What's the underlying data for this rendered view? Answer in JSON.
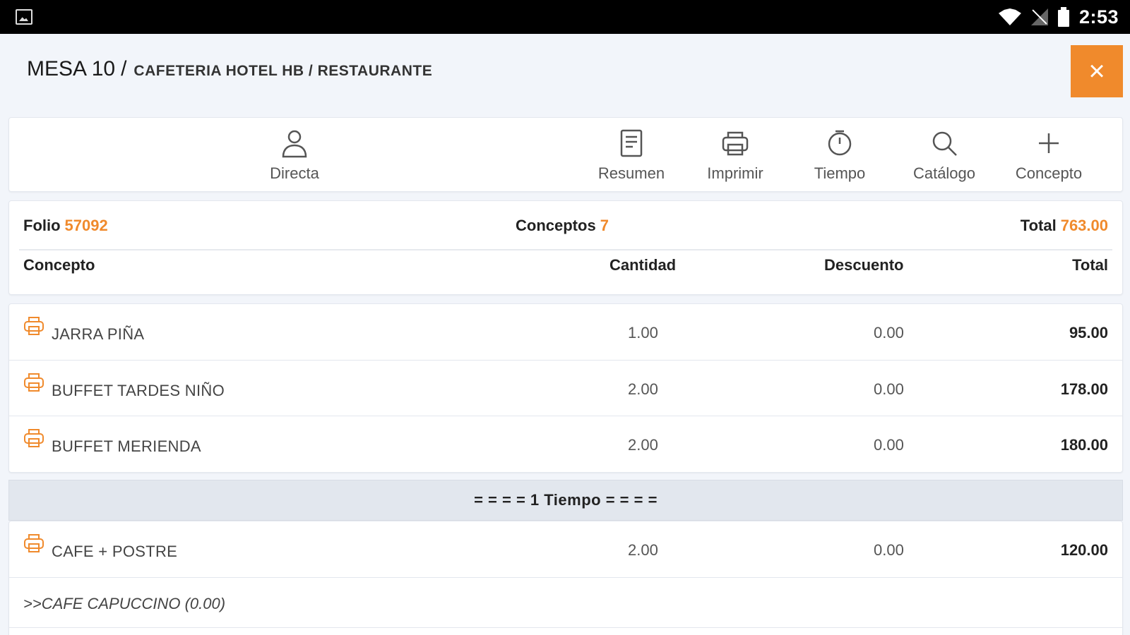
{
  "status_bar": {
    "time": "2:53",
    "icons": [
      "image-notification-icon",
      "wifi-icon",
      "no-signal-icon",
      "battery-icon"
    ]
  },
  "header": {
    "mesa": "MESA 10",
    "separator": "/",
    "location": "CAFETERIA HOTEL HB / RESTAURANTE",
    "close_label": "×"
  },
  "toolbar": {
    "items": [
      {
        "label": "Directa",
        "icon": "person-icon"
      },
      {
        "label": "Resumen",
        "icon": "document-icon"
      },
      {
        "label": "Imprimir",
        "icon": "printer-icon"
      },
      {
        "label": "Tiempo",
        "icon": "clock-icon"
      },
      {
        "label": "Catálogo",
        "icon": "search-icon"
      },
      {
        "label": "Concepto",
        "icon": "plus-icon"
      }
    ]
  },
  "summary": {
    "folio_label": "Folio",
    "folio_value": "57092",
    "conceptos_label": "Conceptos",
    "conceptos_value": "7",
    "total_label": "Total",
    "total_value": "763.00"
  },
  "columns": [
    "Concepto",
    "Cantidad",
    "Descuento",
    "Total"
  ],
  "items": [
    {
      "name": "JARRA PIÑA",
      "cantidad": "1.00",
      "descuento": "0.00",
      "total": "95.00"
    },
    {
      "name": "BUFFET TARDES NIÑO",
      "cantidad": "2.00",
      "descuento": "0.00",
      "total": "178.00"
    },
    {
      "name": "BUFFET MERIENDA",
      "cantidad": "2.00",
      "descuento": "0.00",
      "total": "180.00"
    }
  ],
  "tiempo_separator": "= = = = 1 Tiempo = = = =",
  "items_tiempo1": [
    {
      "name": "CAFE + POSTRE",
      "cantidad": "2.00",
      "descuento": "0.00",
      "total": "120.00",
      "subitem": ">>CAFE CAPUCCINO (0.00)"
    }
  ],
  "colors": {
    "accent": "#f08a2c",
    "background": "#f2f5fa",
    "separator_bg": "#e2e7ee"
  }
}
